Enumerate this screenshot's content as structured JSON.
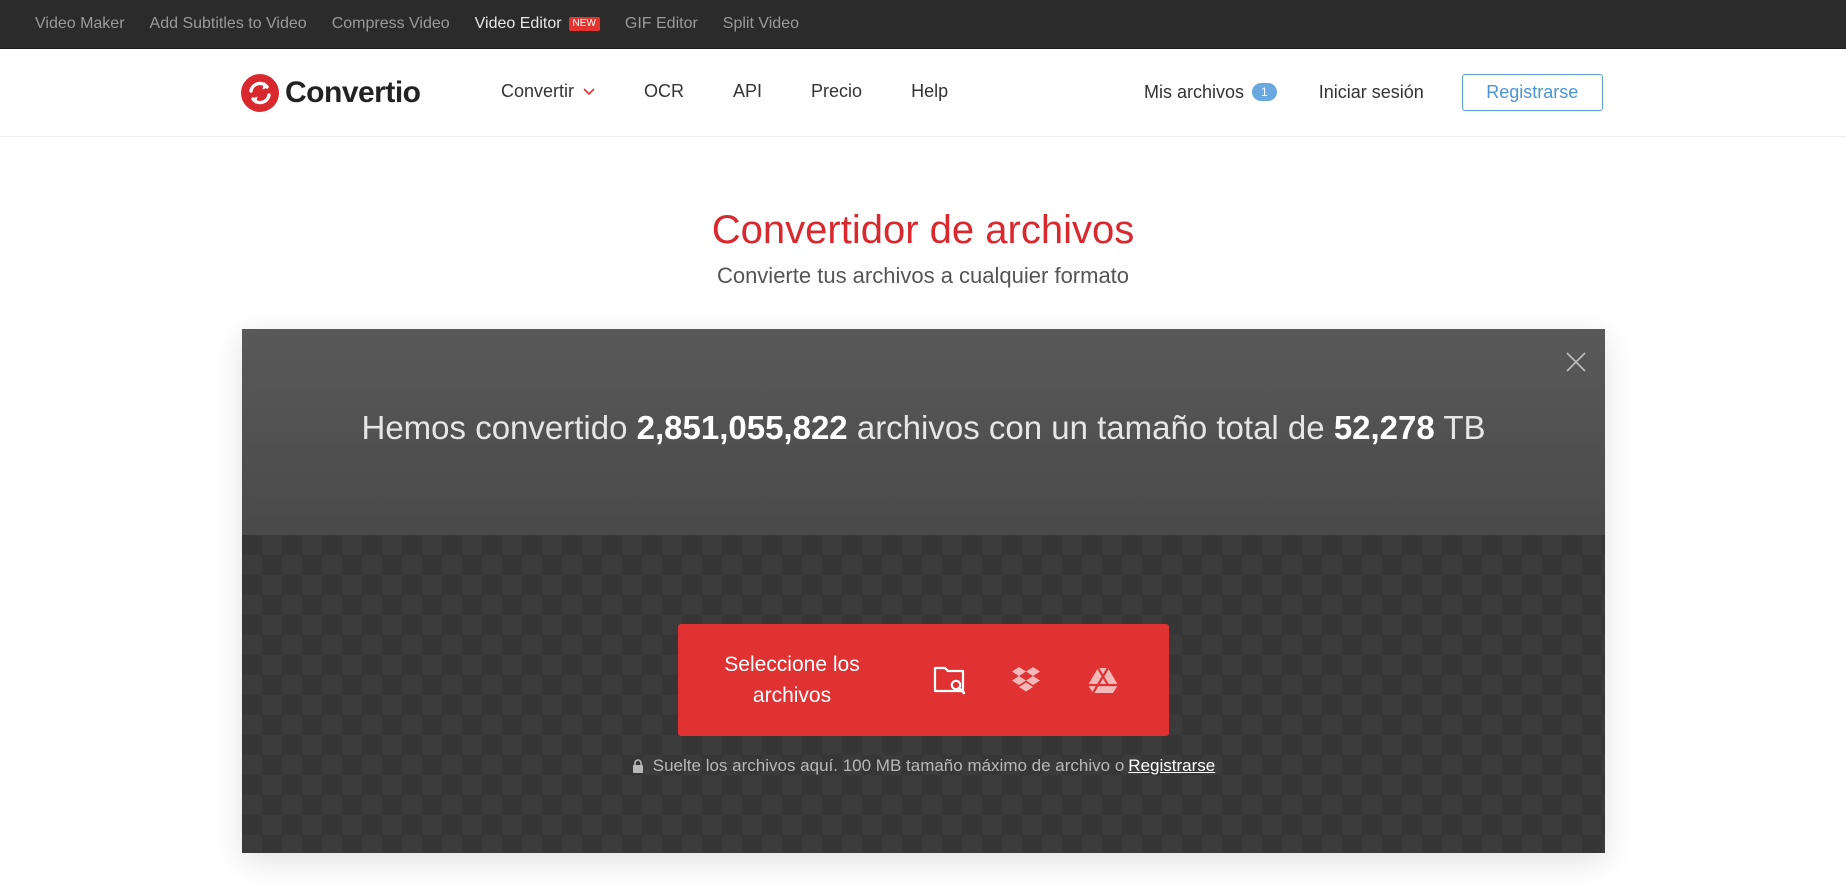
{
  "topbar": {
    "items": [
      {
        "label": "Video Maker",
        "active": false
      },
      {
        "label": "Add Subtitles to Video",
        "active": false
      },
      {
        "label": "Compress Video",
        "active": false
      },
      {
        "label": "Video Editor",
        "active": true,
        "badge": "NEW"
      },
      {
        "label": "GIF Editor",
        "active": false
      },
      {
        "label": "Split Video",
        "active": false
      }
    ]
  },
  "header": {
    "logo_text": "Convertio",
    "nav": [
      {
        "label": "Convertir",
        "dropdown": true
      },
      {
        "label": "OCR"
      },
      {
        "label": "API"
      },
      {
        "label": "Precio"
      },
      {
        "label": "Help"
      }
    ],
    "my_files_label": "Mis archivos",
    "my_files_count": "1",
    "login_label": "Iniciar sesión",
    "register_label": "Registrarse"
  },
  "hero": {
    "title": "Convertidor de archivos",
    "subtitle": "Convierte tus archivos a cualquier formato"
  },
  "panel": {
    "stats_prefix": "Hemos convertido",
    "files_converted": "2,851,055,822",
    "stats_middle": "archivos con un tamaño total de",
    "total_size": "52,278",
    "size_unit": "TB",
    "select_label": "Seleccione los archivos",
    "sources": [
      "folder-search-icon",
      "dropbox-icon",
      "google-drive-icon"
    ],
    "drop_hint": "Suelte los archivos aquí. 100 MB tamaño máximo de archivo o",
    "drop_hint_link": "Registrarse"
  },
  "colors": {
    "brand_red": "#e03232",
    "title_red": "#d9292f",
    "accent_blue": "#5aa0d9",
    "topbar_bg": "#2b2b2b"
  }
}
